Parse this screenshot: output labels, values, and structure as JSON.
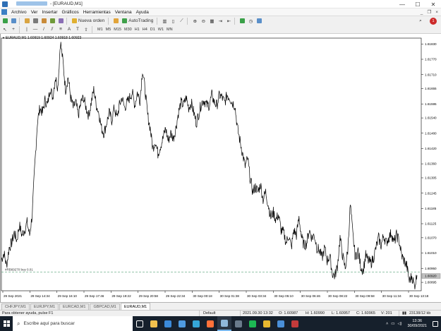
{
  "window": {
    "title": "- [EURAUD,M1]",
    "minimize": "—",
    "maximize": "☐",
    "close": "✕"
  },
  "menu": {
    "items": [
      "Archivo",
      "Ver",
      "Insertar",
      "Gráficos",
      "Herramientas",
      "Ventana",
      "Ayuda"
    ],
    "mdi_controls": [
      "_",
      "❐",
      "×"
    ]
  },
  "toolbar": {
    "new_order": "Nueva orden",
    "auto_trading": "AutoTrading",
    "timeframes": [
      "M1",
      "M5",
      "M15",
      "M30",
      "H1",
      "H4",
      "D1",
      "W1",
      "MN"
    ],
    "notification_count": "1"
  },
  "colors": {
    "bull_bear_line": "#000000",
    "order_line": "#2e8b57",
    "current_price_bg": "#c0c0c0"
  },
  "chart": {
    "header": "EURAUD,M1 1.60919 1.60924 1.60918 1.60923",
    "order_label": "#RB69270 buy 0.01",
    "current_price": "1.60920"
  },
  "chart_data": {
    "type": "line",
    "symbol": "EURAUD",
    "timeframe": "M1",
    "title": "EURAUD,M1 1.60919 1.60924 1.60918 1.60923",
    "xlabel": "",
    "ylabel": "",
    "ylim": [
      1.60862,
      1.61842
    ],
    "y_ticks": [
      "1.61830",
      "1.61770",
      "1.61710",
      "1.61655",
      "1.61595",
      "1.61540",
      "1.61480",
      "1.61420",
      "1.61360",
      "1.61305",
      "1.61245",
      "1.61185",
      "1.61125",
      "1.61070",
      "1.61010",
      "1.60950",
      "1.60895"
    ],
    "x_ticks": [
      "29 Sep 2021",
      "29 Sep 14:34",
      "29 Sep 16:10",
      "29 Sep 17:46",
      "29 Sep 19:22",
      "29 Sep 20:58",
      "29 Sep 22:34",
      "30 Sep 00:18",
      "30 Sep 01:38",
      "30 Sep 03:34",
      "30 Sep 05:10",
      "30 Sep 06:46",
      "30 Sep 08:22",
      "30 Sep 09:58",
      "30 Sep 11:34",
      "30 Sep 13:18"
    ],
    "order_level": 1.60935,
    "current_price": 1.6092,
    "grid": false,
    "series": [
      {
        "values": [
          1.60985,
          1.6101,
          1.6096,
          1.6103,
          1.6105,
          1.6109,
          1.6106,
          1.6112,
          1.6108,
          1.611,
          1.6113,
          1.6108,
          1.6116,
          1.6135,
          1.6152,
          1.6158,
          1.6156,
          1.6161,
          1.6159,
          1.6166,
          1.6162,
          1.617,
          1.6166,
          1.6184,
          1.6176,
          1.6165,
          1.617,
          1.6162,
          1.6158,
          1.616,
          1.6155,
          1.616,
          1.6162,
          1.6158,
          1.6155,
          1.616,
          1.6165,
          1.6159,
          1.6156,
          1.615,
          1.6148,
          1.6152,
          1.6156,
          1.6153,
          1.6158,
          1.6154,
          1.6159,
          1.6162,
          1.6158,
          1.616,
          1.6162,
          1.6164,
          1.6159,
          1.6164,
          1.6161,
          1.6173,
          1.6165,
          1.6155,
          1.615,
          1.6142,
          1.6145,
          1.614,
          1.6143,
          1.6146,
          1.615,
          1.6145,
          1.6148,
          1.6146,
          1.615,
          1.6156,
          1.616,
          1.6159,
          1.6162,
          1.6158,
          1.616,
          1.6156,
          1.6152,
          1.6156,
          1.616,
          1.6161,
          1.6159,
          1.6159,
          1.6163,
          1.616,
          1.6159,
          1.6163,
          1.6162,
          1.616,
          1.6163,
          1.6162,
          1.616,
          1.6159,
          1.615,
          1.6145,
          1.614,
          1.6135,
          1.6138,
          1.613,
          1.6125,
          1.6127,
          1.6125,
          1.6128,
          1.6122,
          1.6125,
          1.612,
          1.6115,
          1.6117,
          1.6114,
          1.6116,
          1.611,
          1.6109,
          1.6105,
          1.6108,
          1.6103,
          1.611,
          1.6108,
          1.6115,
          1.6107,
          1.6104,
          1.6105,
          1.611,
          1.6107,
          1.6108,
          1.6103,
          1.6102,
          1.6099,
          1.6103,
          1.6098,
          1.61,
          1.6093,
          1.6092,
          1.6096,
          1.6107,
          1.61,
          1.6095,
          1.6102,
          1.612,
          1.6108,
          1.6099,
          1.6102,
          1.6096,
          1.6094,
          1.61,
          1.6098,
          1.6097,
          1.6099,
          1.6103,
          1.6107,
          1.6104,
          1.6108,
          1.6105,
          1.6107,
          1.6109,
          1.6105,
          1.6108,
          1.6106,
          1.61,
          1.6098,
          1.6096,
          1.609,
          1.6092,
          1.6088,
          1.60923
        ]
      }
    ]
  },
  "tabs": [
    "CHFJPY,M1",
    "EURJPY,M1",
    "EURCAD,M1",
    "GBPCAD,M1",
    "EURAUD,M1"
  ],
  "active_tab": 4,
  "status": {
    "help": "Para obtener ayuda, pulse F1",
    "profile": "Default",
    "datetime": "2021.09.30 13:32",
    "open": "O: 1.60987",
    "high": "H: 1.60990",
    "low": "L: 1.60957",
    "close": "C: 1.60965",
    "volume": "V: 201",
    "traffic": "23138/12 kb"
  },
  "taskbar": {
    "search_placeholder": "Escribe aquí para buscar",
    "time": "13:36",
    "date": "30/09/2021",
    "app_icons": [
      {
        "name": "task-view-icon",
        "color": "#ffffff"
      },
      {
        "name": "file-explorer-icon",
        "color": "#f2c14e"
      },
      {
        "name": "mail-icon",
        "color": "#3b8ad9"
      },
      {
        "name": "store-icon",
        "color": "#4f9be0"
      },
      {
        "name": "edge-icon",
        "color": "#35a7d8"
      },
      {
        "name": "firefox-icon",
        "color": "#ff7139"
      },
      {
        "name": "metatrader-icon",
        "color": "#8fb8d9"
      },
      {
        "name": "app-icon",
        "color": "#6a7b8c"
      },
      {
        "name": "spotify-icon",
        "color": "#1db954"
      },
      {
        "name": "chrome-icon",
        "color": "#e8b930"
      },
      {
        "name": "app-icon",
        "color": "#4a90d9"
      },
      {
        "name": "app-icon",
        "color": "#c33b3b"
      }
    ]
  }
}
